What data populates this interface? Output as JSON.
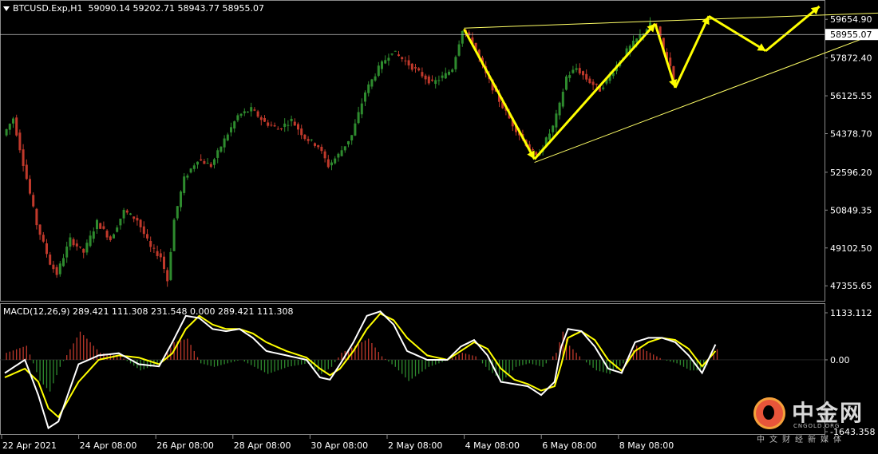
{
  "header": {
    "symbol_line": "BTCUSD.Exp,H1  59090.14 59202.71 58943.77 58955.07",
    "macd_line": "MACD(12,26,9) 289.421 111.308 231.548 0.000 289.421 111.308"
  },
  "watermark": {
    "name_cn": "中金网",
    "name_en": "CNGOLD.ORG",
    "tagline": "中文财经新媒体"
  },
  "colors": {
    "background": "#000000",
    "bull_candle": "#2e8b2e",
    "bear_candle": "#c0392b",
    "annotation": "#ffff00",
    "trendline": "#ffff66",
    "macd_main": "#ffffff",
    "macd_signal": "#ffff00",
    "axis_text": "#ffffff",
    "grid_line": "#8a8a8a"
  },
  "chart_data": [
    {
      "type": "candlestick",
      "title": "BTCUSD.Exp,H1",
      "x_tick_labels": [
        "22 Apr 2021",
        "24 Apr 08:00",
        "26 Apr 08:00",
        "28 Apr 08:00",
        "30 Apr 08:00",
        "2 May 08:00",
        "4 May 08:00",
        "6 May 08:00",
        "8 May 08:00"
      ],
      "y_tick_labels": [
        "59654.90",
        "57872.40",
        "56125.55",
        "54378.70",
        "52596.20",
        "50849.35",
        "49102.50",
        "47355.65"
      ],
      "y_ticks": [
        59654.9,
        57872.4,
        56125.55,
        54378.7,
        52596.2,
        50849.35,
        49102.5,
        47355.65
      ],
      "ylim": [
        46700,
        60400
      ],
      "current_price": 58955.07,
      "current_price_label": "58955.07",
      "bar_count": 200,
      "price_path": [
        [
          0,
          54300
        ],
        [
          3,
          55100
        ],
        [
          6,
          53000
        ],
        [
          10,
          50200
        ],
        [
          14,
          48400
        ],
        [
          16,
          47900
        ],
        [
          20,
          49500
        ],
        [
          24,
          48900
        ],
        [
          28,
          50300
        ],
        [
          32,
          49500
        ],
        [
          36,
          50800
        ],
        [
          40,
          50400
        ],
        [
          44,
          49100
        ],
        [
          47,
          48700
        ],
        [
          49,
          47600
        ],
        [
          51,
          50400
        ],
        [
          54,
          52300
        ],
        [
          58,
          53200
        ],
        [
          62,
          52900
        ],
        [
          66,
          54100
        ],
        [
          70,
          55200
        ],
        [
          74,
          55500
        ],
        [
          78,
          54900
        ],
        [
          82,
          54600
        ],
        [
          86,
          55000
        ],
        [
          90,
          54200
        ],
        [
          94,
          53800
        ],
        [
          97,
          52900
        ],
        [
          100,
          53400
        ],
        [
          104,
          54300
        ],
        [
          108,
          56300
        ],
        [
          112,
          57400
        ],
        [
          116,
          58200
        ],
        [
          120,
          57700
        ],
        [
          124,
          57200
        ],
        [
          128,
          56700
        ],
        [
          132,
          57100
        ],
        [
          134,
          57400
        ],
        [
          137,
          59200
        ],
        [
          140,
          58600
        ],
        [
          144,
          57100
        ],
        [
          148,
          55900
        ],
        [
          152,
          54800
        ],
        [
          156,
          53900
        ],
        [
          159,
          53300
        ],
        [
          161,
          53800
        ],
        [
          164,
          54700
        ],
        [
          166,
          55700
        ],
        [
          168,
          57000
        ],
        [
          171,
          57400
        ],
        [
          174,
          56900
        ],
        [
          178,
          56400
        ],
        [
          182,
          57300
        ],
        [
          186,
          58200
        ],
        [
          190,
          58900
        ],
        [
          193,
          59400
        ],
        [
          195,
          59300
        ],
        [
          197,
          58200
        ],
        [
          199,
          57500
        ],
        [
          201,
          56400
        ],
        [
          204,
          57200
        ],
        [
          207,
          58300
        ],
        [
          210,
          59100
        ],
        [
          212,
          58955
        ]
      ],
      "annotation_arrows_price": [
        [
          [
            137,
            59200
          ],
          [
            158,
            53200
          ],
          [
            194,
            59450
          ],
          [
            200,
            56500
          ],
          [
            210,
            59800
          ],
          [
            227,
            58200
          ],
          [
            243,
            60250
          ]
        ]
      ],
      "trendlines_price": [
        [
          [
            137,
            59250
          ],
          [
            270,
            60000
          ]
        ],
        [
          [
            158,
            53050
          ],
          [
            272,
            59700
          ]
        ]
      ]
    },
    {
      "type": "macd",
      "title": "MACD(12,26,9)",
      "params": [
        12,
        26,
        9
      ],
      "values_shown": [
        289.421,
        111.308,
        231.548,
        0.0,
        289.421,
        111.308
      ],
      "y_tick_labels": [
        "1133.112",
        "0.00",
        "-1643.358"
      ],
      "y_ticks": [
        1133.112,
        0.0,
        -1643.358
      ],
      "ylim": [
        -1650,
        1250
      ],
      "main_path": [
        [
          0,
          -300
        ],
        [
          6,
          0
        ],
        [
          10,
          -800
        ],
        [
          13,
          -1550
        ],
        [
          16,
          -1400
        ],
        [
          22,
          -100
        ],
        [
          28,
          100
        ],
        [
          34,
          150
        ],
        [
          40,
          -100
        ],
        [
          46,
          -150
        ],
        [
          50,
          400
        ],
        [
          54,
          1000
        ],
        [
          58,
          950
        ],
        [
          62,
          700
        ],
        [
          66,
          650
        ],
        [
          70,
          700
        ],
        [
          74,
          500
        ],
        [
          78,
          200
        ],
        [
          84,
          100
        ],
        [
          90,
          0
        ],
        [
          94,
          -400
        ],
        [
          97,
          -450
        ],
        [
          100,
          -100
        ],
        [
          104,
          400
        ],
        [
          108,
          1000
        ],
        [
          112,
          1100
        ],
        [
          116,
          800
        ],
        [
          120,
          200
        ],
        [
          126,
          0
        ],
        [
          132,
          0
        ],
        [
          136,
          300
        ],
        [
          140,
          450
        ],
        [
          144,
          100
        ],
        [
          148,
          -500
        ],
        [
          152,
          -550
        ],
        [
          156,
          -600
        ],
        [
          160,
          -800
        ],
        [
          164,
          -500
        ],
        [
          166,
          300
        ],
        [
          168,
          700
        ],
        [
          172,
          650
        ],
        [
          176,
          300
        ],
        [
          180,
          -200
        ],
        [
          184,
          -300
        ],
        [
          188,
          400
        ],
        [
          192,
          500
        ],
        [
          196,
          500
        ],
        [
          200,
          400
        ],
        [
          204,
          100
        ],
        [
          208,
          -300
        ],
        [
          212,
          350
        ]
      ],
      "signal_path": [
        [
          0,
          -400
        ],
        [
          6,
          -200
        ],
        [
          10,
          -500
        ],
        [
          13,
          -1100
        ],
        [
          16,
          -1300
        ],
        [
          22,
          -500
        ],
        [
          28,
          0
        ],
        [
          34,
          100
        ],
        [
          40,
          50
        ],
        [
          46,
          -100
        ],
        [
          50,
          150
        ],
        [
          54,
          700
        ],
        [
          58,
          1000
        ],
        [
          62,
          800
        ],
        [
          66,
          700
        ],
        [
          70,
          700
        ],
        [
          74,
          600
        ],
        [
          78,
          400
        ],
        [
          84,
          200
        ],
        [
          90,
          50
        ],
        [
          94,
          -200
        ],
        [
          97,
          -350
        ],
        [
          100,
          -200
        ],
        [
          104,
          200
        ],
        [
          108,
          700
        ],
        [
          112,
          1050
        ],
        [
          116,
          900
        ],
        [
          120,
          500
        ],
        [
          126,
          100
        ],
        [
          132,
          0
        ],
        [
          136,
          200
        ],
        [
          140,
          400
        ],
        [
          144,
          250
        ],
        [
          148,
          -200
        ],
        [
          152,
          -450
        ],
        [
          156,
          -550
        ],
        [
          160,
          -700
        ],
        [
          164,
          -600
        ],
        [
          166,
          -100
        ],
        [
          168,
          500
        ],
        [
          172,
          650
        ],
        [
          176,
          450
        ],
        [
          180,
          0
        ],
        [
          184,
          -250
        ],
        [
          188,
          200
        ],
        [
          192,
          400
        ],
        [
          196,
          500
        ],
        [
          200,
          450
        ],
        [
          204,
          250
        ],
        [
          208,
          -150
        ],
        [
          212,
          200
        ]
      ]
    }
  ]
}
